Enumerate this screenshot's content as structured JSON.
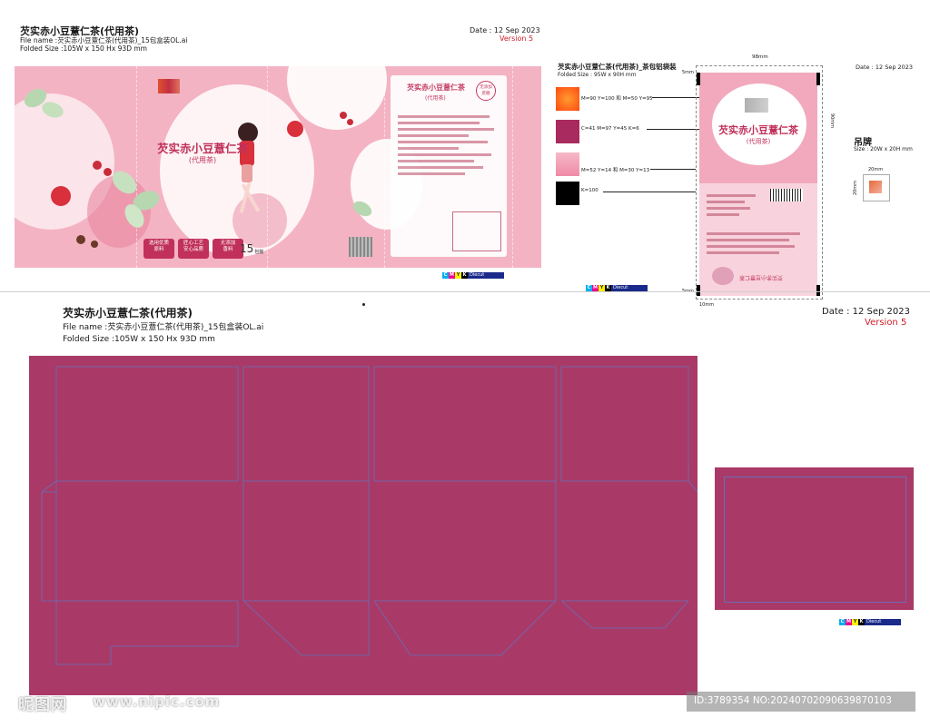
{
  "top_header": {
    "title": "芡实赤小豆薏仁茶(代用茶)",
    "file_name": "File name :芡实赤小豆薏仁茶(代用茶)_15包盒装OL.ai",
    "folded_size": "Folded Size :105W x 150 Hx 93D mm",
    "date": "Date : 12 Sep 2023",
    "version": "Version 5"
  },
  "box_front": {
    "product_name": "芡实赤小豆薏仁茶",
    "sub_name": "(代用茶)",
    "count_num": "15",
    "count_unit": "包装",
    "badges": [
      "选用优质\n原料",
      "匠心工艺\n安心品质",
      "无添加\n香料"
    ],
    "side_title": "芡实赤小豆薏仁茶",
    "side_sub": "(代用茶)",
    "seal_text": "无添加\n蔗糖"
  },
  "colors": {
    "pink_main": "#f3b0c1",
    "magenta": "#a93a68",
    "orange": "#ff7a20",
    "red": "#e63a2a",
    "black": "#000000"
  },
  "sachet": {
    "title": "芡实赤小豆薏仁茶(代用茶)_茶包铝袋装",
    "folded_size": "Folded Size : 95W x 90H mm",
    "width_label": "98mm",
    "height_label": "90mm",
    "margin_label": "5mm",
    "bottom_label": "10mm",
    "date": "Date : 12 Sep 2023",
    "product_name": "芡实赤小豆薏仁茶",
    "sub_name": "(代用茶)"
  },
  "swatches": [
    {
      "label": "M=90 Y=100 和 M=50 Y=95",
      "color": "#ff5a1a"
    },
    {
      "label": "C=41 M=97 Y=45 K=6",
      "color": "#a82a5e"
    },
    {
      "label": "M=52 Y=14 和 M=30 Y=13",
      "color": "#f3a2b8"
    },
    {
      "label": "K=100",
      "color": "#000000"
    }
  ],
  "hangtag": {
    "title": "吊牌",
    "size": "Size : 20W x 20H mm",
    "w_label": "20mm",
    "h_label": "20mm"
  },
  "bottom_header": {
    "title": "芡实赤小豆薏仁茶(代用茶)",
    "file_name": "File name :芡实赤小豆薏仁茶(代用茶)_15包盒装OL.ai",
    "folded_size": "Folded Size :105W x 150 Hx 93D mm",
    "date": "Date : 12 Sep 2023",
    "version": "Version 5"
  },
  "cmyk_marks": {
    "c": "C",
    "m": "M",
    "y": "Y",
    "k": "K",
    "diecut": "Diecut"
  },
  "watermark": {
    "site_cn": "昵图网",
    "site_url": "www.nipic.com",
    "id_text": "ID:3789354 NO:20240702090639870103"
  }
}
